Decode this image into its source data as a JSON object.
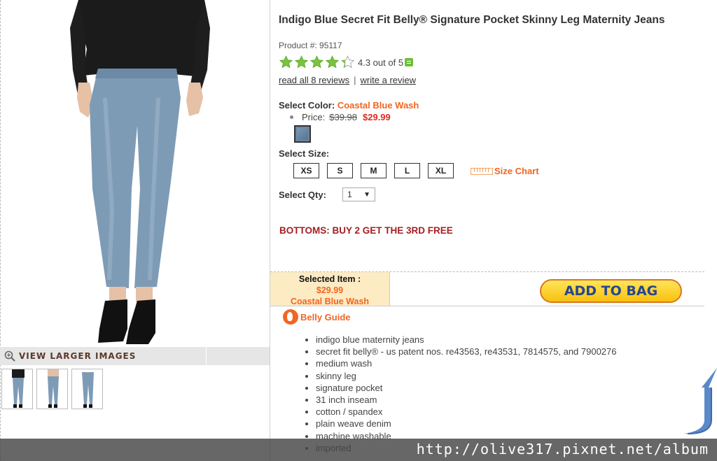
{
  "left": {
    "view_larger_label": "VIEW LARGER IMAGES"
  },
  "product": {
    "title": "Indigo Blue Secret Fit Belly® Signature Pocket Skinny Leg Maternity Jeans",
    "product_number": "Product #: 95117",
    "rating_value": 4.3,
    "rating_text": "4.3 out of 5",
    "read_reviews": "read all 8 reviews",
    "separator": "|",
    "write_review": "write a review"
  },
  "color": {
    "label": "Select Color:",
    "value": "Coastal Blue Wash",
    "price_label": "Price:",
    "old_price": "$39.98",
    "new_price": "$29.99",
    "swatch_color": "#6a87a6"
  },
  "size": {
    "label": "Select Size:",
    "options": [
      "XS",
      "S",
      "M",
      "L",
      "XL"
    ],
    "chart_label": "Size Chart"
  },
  "qty": {
    "label": "Select Qty:",
    "value": "1",
    "arrow": "▼"
  },
  "promo": "BOTTOMS: BUY 2 GET THE 3RD FREE",
  "selected": {
    "title": "Selected Item :",
    "price": "$29.99",
    "color": "Coastal Blue Wash"
  },
  "add_to_bag": "ADD TO BAG",
  "belly_guide": "Belly Guide",
  "features": [
    "indigo blue maternity jeans",
    "secret fit belly® - us patent nos. re43563, re43531, 7814575, and 7900276",
    "medium wash",
    "skinny leg",
    "signature pocket",
    "31 inch inseam",
    "cotton / spandex",
    "plain weave denim",
    "machine washable",
    "imported"
  ],
  "watermark": "http://olive317.pixnet.net/album",
  "colors": {
    "accent_orange": "#f26522",
    "price_red": "#e8281c",
    "promo_red": "#a31f24",
    "star_green": "#7cc242",
    "button_yellow": "#f8c10f",
    "button_text": "#27468f"
  }
}
